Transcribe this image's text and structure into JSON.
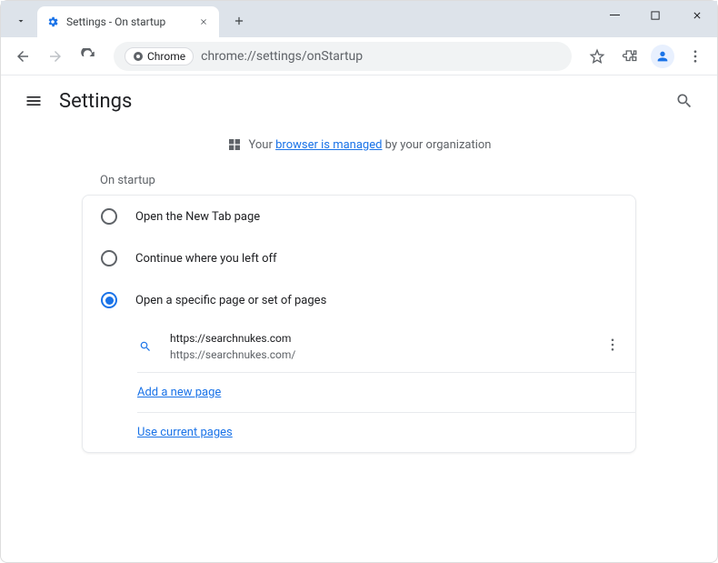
{
  "window": {
    "tab_title": "Settings - On startup",
    "url": "chrome://settings/onStartup",
    "chrome_chip": "Chrome"
  },
  "header": {
    "title": "Settings"
  },
  "managed": {
    "prefix": "Your ",
    "link": "browser is managed",
    "suffix": " by your organization"
  },
  "section": {
    "title": "On startup",
    "options": [
      {
        "label": "Open the New Tab page"
      },
      {
        "label": "Continue where you left off"
      },
      {
        "label": "Open a specific page or set of pages"
      }
    ],
    "selected_index": 2,
    "startup_page": {
      "title": "https://searchnukes.com",
      "url": "https://searchnukes.com/"
    },
    "add_link": "Add a new page",
    "use_current_link": "Use current pages"
  }
}
